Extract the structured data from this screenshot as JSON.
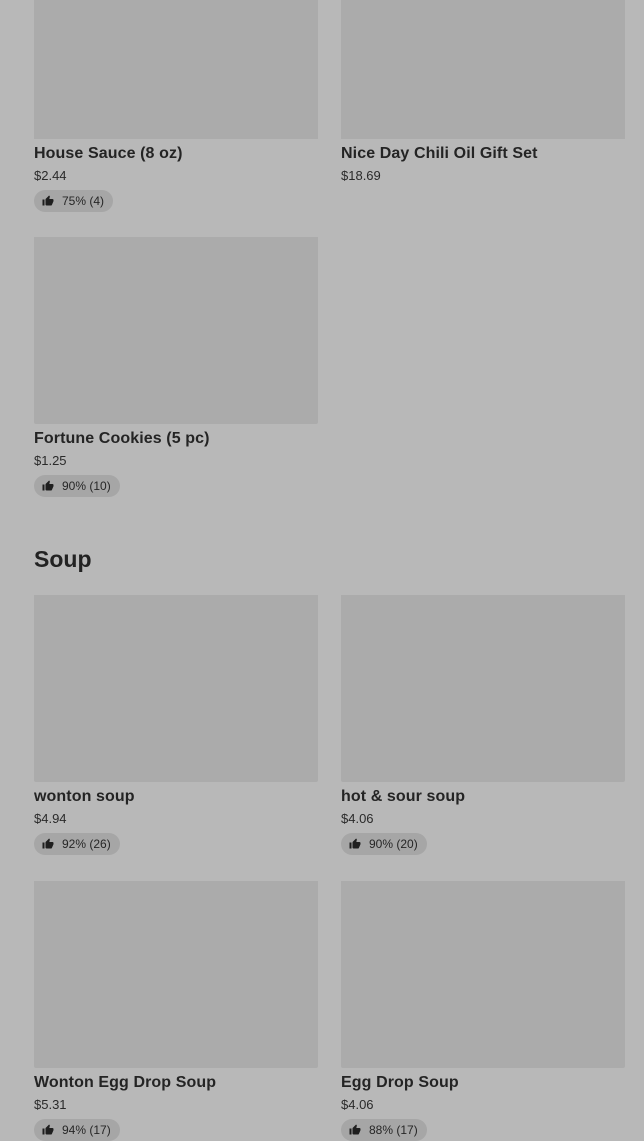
{
  "top_items": [
    {
      "name": "House Sauce (8 oz)",
      "price": "$2.44",
      "rating": "75% (4)",
      "icon": "thumbs-up-icon"
    },
    {
      "name": "Nice Day Chili Oil Gift Set",
      "price": "$18.69"
    },
    {
      "name": "Fortune Cookies (5 pc)",
      "price": "$1.25",
      "rating": "90% (10)",
      "icon": "thumbs-up-icon"
    }
  ],
  "soup_section": {
    "title": "Soup",
    "items": [
      {
        "name": "wonton soup",
        "price": "$4.94",
        "rating": "92% (26)",
        "icon": "thumbs-up-icon"
      },
      {
        "name": "hot & sour soup",
        "price": "$4.06",
        "rating": "90% (20)",
        "icon": "thumbs-up-icon"
      },
      {
        "name": "Wonton Egg Drop Soup",
        "price": "$5.31",
        "rating": "94% (17)",
        "icon": "thumbs-up-icon"
      },
      {
        "name": "Egg Drop Soup",
        "price": "$4.06",
        "rating": "88% (17)",
        "icon": "thumbs-up-icon"
      }
    ]
  }
}
